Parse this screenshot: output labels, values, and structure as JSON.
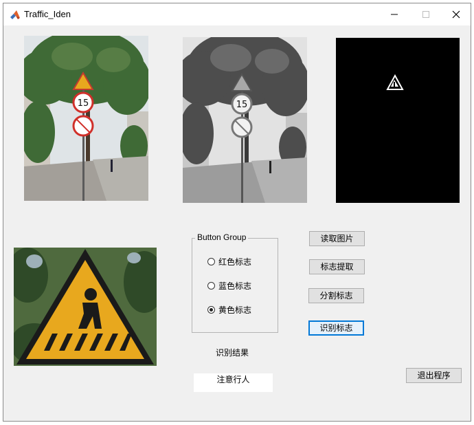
{
  "window": {
    "title": "Traffic_Iden"
  },
  "button_group": {
    "title": "Button Group",
    "options": [
      {
        "label": "红色标志",
        "selected": false
      },
      {
        "label": "蓝色标志",
        "selected": false
      },
      {
        "label": "黄色标志",
        "selected": true
      }
    ]
  },
  "buttons": {
    "read_image": "读取图片",
    "extract_sign": "标志提取",
    "segment_sign": "分割标志",
    "identify_sign": "识别标志",
    "exit": "退出程序"
  },
  "result": {
    "label": "识别结果",
    "value": "注意行人"
  },
  "images": {
    "original": "street-scene-photo",
    "grayscale": "street-scene-grayscale",
    "binary": "binary-mask",
    "segmented": "pedestrian-crossing-sign-crop"
  },
  "colors": {
    "sign_yellow": "#e8a81e",
    "sign_red": "#d0302a",
    "button_face": "#e1e1e1",
    "focus_blue": "#0078d7"
  }
}
